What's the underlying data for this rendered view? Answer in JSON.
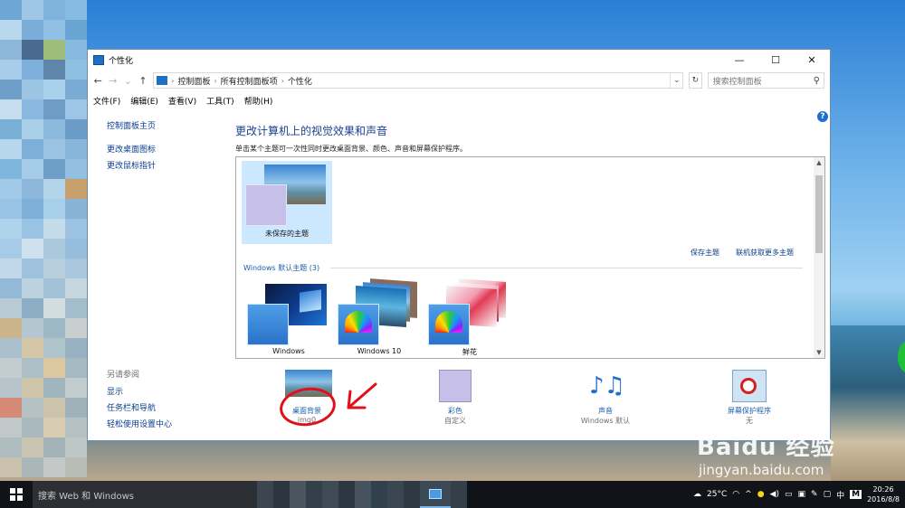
{
  "window": {
    "title": "个性化",
    "minimize": "—",
    "maximize": "☐",
    "close": "✕"
  },
  "address": {
    "breadcrumb": [
      "控制面板",
      "所有控制面板项",
      "个性化"
    ],
    "search_placeholder": "搜索控制面板"
  },
  "menu": [
    "文件(F)",
    "编辑(E)",
    "查看(V)",
    "工具(T)",
    "帮助(H)"
  ],
  "left_pane": {
    "links": [
      "控制面板主页",
      "更改桌面图标",
      "更改鼠标指针"
    ],
    "see_also_heading": "另请参阅",
    "see_also": [
      "显示",
      "任务栏和导航",
      "轻松使用设置中心"
    ]
  },
  "main": {
    "heading": "更改计算机上的视觉效果和声音",
    "subtext": "单击某个主题可一次性同时更改桌面背景、颜色、声音和屏幕保护程序。",
    "unsaved_theme": "未保存的主题",
    "save_theme": "保存主题",
    "get_more": "联机获取更多主题",
    "group_label": "Windows 默认主题 (3)",
    "themes": [
      "Windows",
      "Windows 10",
      "鲜花"
    ]
  },
  "bottom": [
    {
      "label": "桌面背景",
      "sub": "img0"
    },
    {
      "label": "彩色",
      "sub": "自定义"
    },
    {
      "label": "声音",
      "sub": "Windows 默认"
    },
    {
      "label": "屏幕保护程序",
      "sub": "无"
    }
  ],
  "taskbar": {
    "search": "搜索 Web 和 Windows",
    "weather": "25°C",
    "ime": "中",
    "ime2": "M",
    "time": "20:26",
    "date": "2016/8/8"
  },
  "watermark": {
    "main": "Baidu 经验",
    "sub": "jingyan.baidu.com"
  },
  "colors": {
    "accent": "#1d3f8f",
    "link": "#0b3c8f",
    "selection": "#cce8ff",
    "annotation": "#e0101a"
  }
}
